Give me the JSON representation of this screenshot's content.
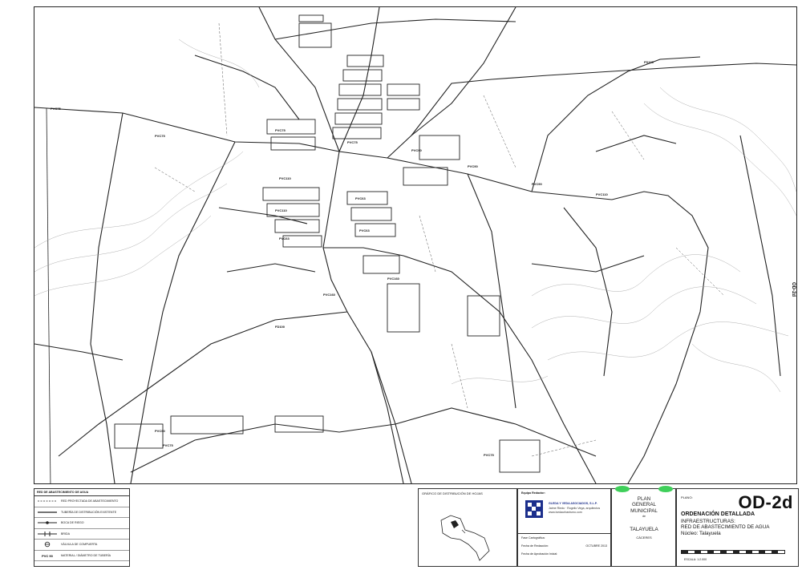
{
  "map": {
    "sheet_side_code": "OD-2d",
    "street_labels": [
      "PVC75",
      "PVC75",
      "PVC75",
      "PVC75",
      "PVC90",
      "PVC90",
      "PVC90",
      "PVC110",
      "PVC110",
      "PVC110",
      "PVC63",
      "PVC63",
      "PVC63",
      "PVC160",
      "PVC160",
      "FD100",
      "FD100",
      "PVC75",
      "PVC90",
      "PVC75"
    ]
  },
  "legend": {
    "title": "RED DE ABASTECIMIENTO DE AGUA",
    "items": [
      {
        "symbol": "dashed-line",
        "label": "RED PROYECTADA DE ABASTECIMIENTO"
      },
      {
        "symbol": "solid-line",
        "label": "TUBERÍA DE DISTRIBUCIÓN EXISTENTE"
      },
      {
        "symbol": "line-dot",
        "label": "BOCA DE RIEGO"
      },
      {
        "symbol": "line-bracket",
        "label": "BRIDA"
      },
      {
        "symbol": "valve",
        "label": "VÁLVULA DE COMPUERTA"
      },
      {
        "symbol": "text-code",
        "symbol_text": "PVC 90",
        "label": "MATERIAL / DIÁMETRO DE TUBERÍA"
      }
    ]
  },
  "sheets": {
    "title": "GRÁFICO DE DISTRIBUCIÓN DE HOJAS"
  },
  "team": {
    "label": "Equipo Redactor:",
    "company": "GLEDA Y VEDA ASOCIADOS, S.L.P.",
    "people": "Jaime Riedo · Rogelio Vega, arquitectos",
    "web": "www.ivedaurbanismo.com"
  },
  "dates": {
    "label": "Fase Cartográfica:",
    "drafting_label": "Fecha de Redacción:",
    "drafting_value": "OCTUBRE 2013",
    "approval_label": "Fecha de Aprobación Inicial:",
    "approval_value": ""
  },
  "plan": {
    "title_lines": [
      "PLAN",
      "GENERAL",
      "MUNICIPAL"
    ],
    "connector": "de",
    "town": "TALAYUELA",
    "province": "CÁCERES"
  },
  "cover": {
    "plano_label": "PLANO:",
    "code": "OD-2d",
    "subtitle": "ORDENACIÓN DETALLADA",
    "lines": [
      "INFRAESTRUCTURAS:",
      "RED DE ABASTECIMIENTO DE AGUA",
      "Núcleo: Talayuela"
    ],
    "scale_label": "ESCALA:",
    "scale_value": "1:2.000"
  },
  "colors": {
    "accent_green": "#3fcf5a",
    "brand_blue": "#1c2f8c"
  }
}
